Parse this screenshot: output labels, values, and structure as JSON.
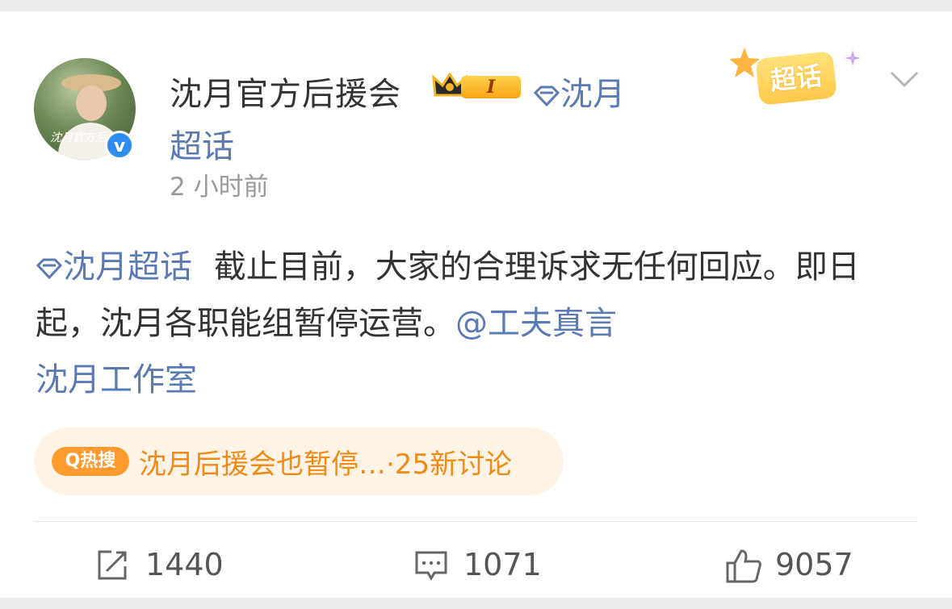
{
  "post": {
    "author": "沈月官方后援会",
    "level": "I",
    "topic_link_1": "沈月",
    "topic_link_2": "超话",
    "time": "2 小时前",
    "supertopic_badge": "超话",
    "content_topic": "沈月超话",
    "content_text": "截止目前，大家的合理诉求无任何回应。即日起，沈月各职能组暂停运营。",
    "mention_1": "@工夫真言",
    "mention_2": "沈月工作室",
    "avatar_watermark": "沈月官方后援"
  },
  "hot_search": {
    "tag": "Q热搜",
    "text": "沈月后援会也暂停…",
    "suffix": "·25新讨论"
  },
  "actions": {
    "repost_count": "1440",
    "comment_count": "1071",
    "like_count": "9057"
  },
  "colors": {
    "link": "#5b7ab3",
    "hot_orange": "#f08a16",
    "verified_blue": "#2d8cf0"
  },
  "icons": [
    "verified-icon",
    "crown-icon",
    "supertopic-diamond-icon",
    "chevron-down-icon",
    "repost-icon",
    "comment-icon",
    "like-icon"
  ]
}
